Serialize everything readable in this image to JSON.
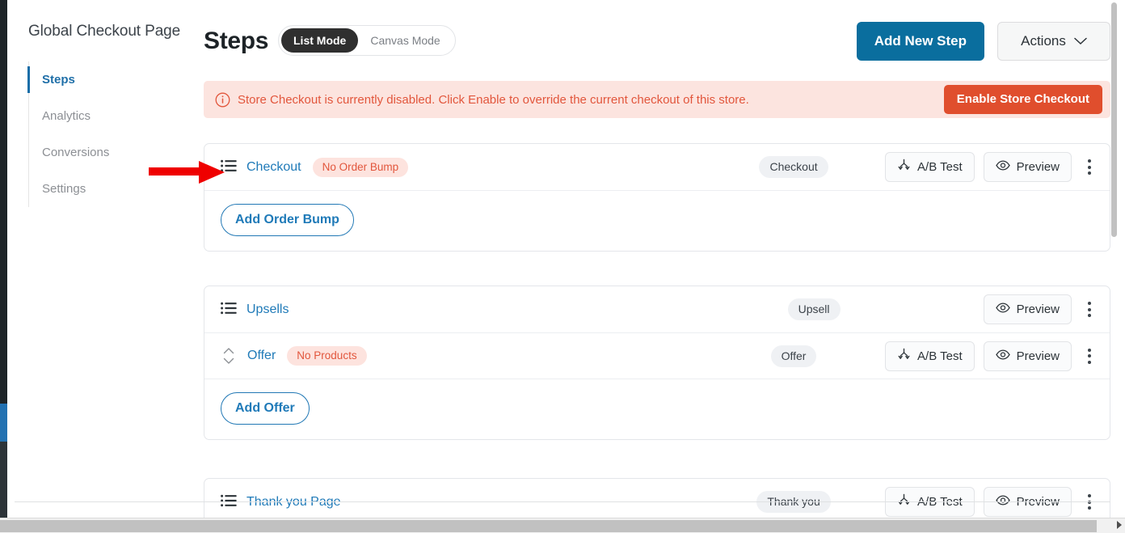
{
  "colors": {
    "accent_blue": "#0a6e9e",
    "link_blue": "#1f7ab8",
    "danger_red": "#e2563c",
    "danger_btn": "#e04e2d",
    "notice_bg": "#fce4df",
    "pill_grey": "#eff1f4",
    "toggle_dark": "#2f2f2f",
    "wp_sidebar": "#1d2327",
    "wp_sidebar_active": "#2271b1",
    "annotation_arrow": "#ef0000"
  },
  "sidebar": {
    "title": "Global Checkout Page",
    "items": [
      {
        "label": "Steps",
        "active": true
      },
      {
        "label": "Analytics",
        "active": false
      },
      {
        "label": "Conversions",
        "active": false
      },
      {
        "label": "Settings",
        "active": false
      }
    ]
  },
  "header": {
    "title": "Steps",
    "modes": [
      {
        "label": "List Mode",
        "selected": true
      },
      {
        "label": "Canvas Mode",
        "selected": false
      }
    ],
    "add_step_label": "Add New Step",
    "actions_label": "Actions",
    "actions_icon": "chevron-down-icon"
  },
  "notice": {
    "icon": "info-circle-icon",
    "text": "Store Checkout is currently disabled. Click Enable to override the current checkout of this store.",
    "button_label": "Enable Store Checkout"
  },
  "common": {
    "ab_test_label": "A/B Test",
    "ab_test_icon": "split-arrows-icon",
    "preview_label": "Preview",
    "preview_icon": "eye-icon",
    "kebab_icon": "more-vertical-icon",
    "grip_icon": "list-lines-icon",
    "sort_icon": "chevron-up-down-icon"
  },
  "cards": [
    {
      "rows": [
        {
          "icon": "list-lines-icon",
          "name": "Checkout",
          "badge": "No Order Bump",
          "type": "Checkout",
          "has_ab_test": true,
          "has_preview": true,
          "has_kebab": true
        }
      ],
      "footer_button": "Add Order Bump"
    },
    {
      "rows": [
        {
          "icon": "list-lines-icon",
          "name": "Upsells",
          "badge": null,
          "type": "Upsell",
          "has_ab_test": false,
          "has_preview": true,
          "has_kebab": true
        },
        {
          "icon": "chevron-up-down-icon",
          "name": "Offer",
          "badge": "No Products",
          "type": "Offer",
          "has_ab_test": true,
          "has_preview": true,
          "has_kebab": true
        }
      ],
      "footer_button": "Add Offer"
    },
    {
      "rows": [
        {
          "icon": "list-lines-icon",
          "name": "Thank you Page",
          "badge": null,
          "type": "Thank you",
          "has_ab_test": true,
          "has_preview": true,
          "has_kebab": true
        }
      ],
      "footer_button": null
    }
  ]
}
